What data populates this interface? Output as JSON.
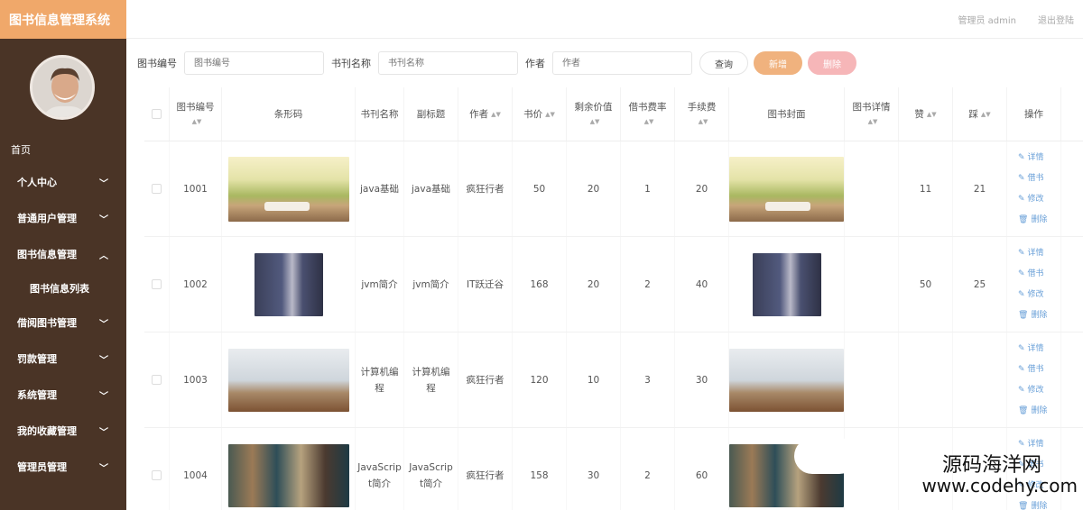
{
  "app": {
    "title": "图书信息管理系统"
  },
  "header": {
    "user": "管理员 admin",
    "logout": "退出登陆"
  },
  "sidebar": {
    "home": "首页",
    "items": [
      {
        "label": "个人中心",
        "chevron": "﹀"
      },
      {
        "label": "普通用户管理",
        "chevron": "﹀"
      },
      {
        "label": "图书信息管理",
        "chevron": "︿"
      },
      {
        "label": "图书信息列表",
        "chevron": ""
      },
      {
        "label": "借阅图书管理",
        "chevron": "﹀"
      },
      {
        "label": "罚款管理",
        "chevron": "﹀"
      },
      {
        "label": "系统管理",
        "chevron": "﹀"
      },
      {
        "label": "我的收藏管理",
        "chevron": "﹀"
      },
      {
        "label": "管理员管理",
        "chevron": "﹀"
      }
    ]
  },
  "search": {
    "label_id": "图书编号",
    "placeholder_id": "图书编号",
    "label_name": "书刊名称",
    "placeholder_name": "书刊名称",
    "label_author": "作者",
    "placeholder_author": "作者",
    "query": "查询",
    "add": "新增",
    "delete": "删除"
  },
  "table": {
    "headers": {
      "id": "图书编号",
      "barcode": "条形码",
      "name": "书刊名称",
      "subtitle": "副标题",
      "author": "作者",
      "price": "书价",
      "remain": "剩余价值",
      "rate": "借书费率",
      "fee": "手续费",
      "cover": "图书封面",
      "detail": "图书详情",
      "like": "赞",
      "dislike": "踩",
      "ops": "操作"
    },
    "ops": {
      "detail": "详情",
      "borrow": "借书",
      "edit": "修改",
      "delete": "删除"
    },
    "rows": [
      {
        "id": "1001",
        "name": "java基础",
        "subtitle": "java基础",
        "author": "疯狂行者",
        "price": "50",
        "remain": "20",
        "rate": "1",
        "fee": "20",
        "like": "11",
        "dislike": "21"
      },
      {
        "id": "1002",
        "name": "jvm简介",
        "subtitle": "jvm简介",
        "author": "IT跃迁谷",
        "price": "168",
        "remain": "20",
        "rate": "2",
        "fee": "40",
        "like": "50",
        "dislike": "25"
      },
      {
        "id": "1003",
        "name": "计算机编程",
        "subtitle": "计算机编程",
        "author": "疯狂行者",
        "price": "120",
        "remain": "10",
        "rate": "3",
        "fee": "30",
        "like": "",
        "dislike": ""
      },
      {
        "id": "1004",
        "name": "JavaScript简介",
        "subtitle": "JavaScript简介",
        "author": "疯狂行者",
        "price": "158",
        "remain": "30",
        "rate": "2",
        "fee": "60",
        "like": "",
        "dislike": ""
      }
    ]
  },
  "watermark": {
    "line1": "源码海洋网",
    "line2": "www.codehy.com"
  }
}
